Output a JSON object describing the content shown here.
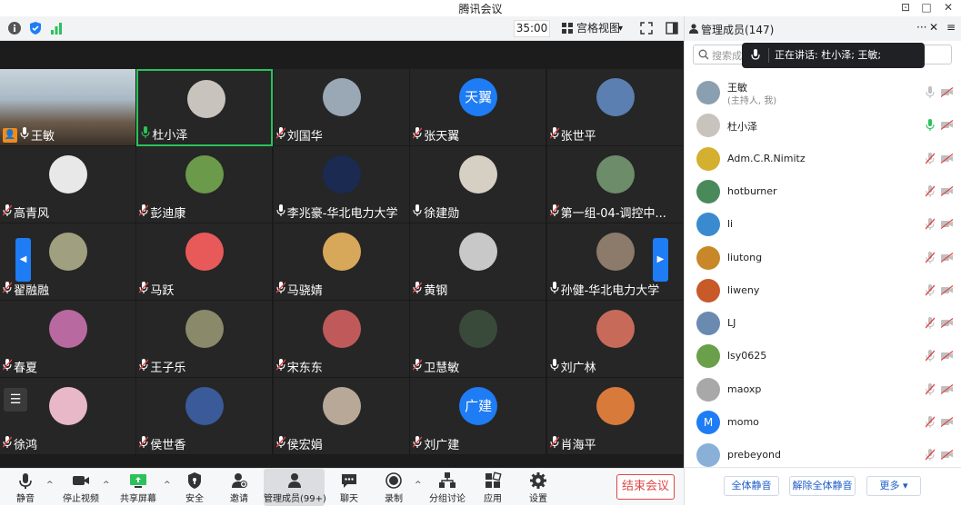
{
  "window": {
    "title": "腾讯会议",
    "pin": "⊡",
    "maximize": "□",
    "close": "✕"
  },
  "topbar": {
    "timer": "35:00",
    "view_mode": "宫格视图",
    "view_caret": "▾"
  },
  "tiles": [
    {
      "name": "王敏",
      "muted": false,
      "host": true,
      "avatar_color": "#8aa0b0"
    },
    {
      "name": "杜小泽",
      "muted": false,
      "active": true,
      "avatar_color": "#c9c3bd"
    },
    {
      "name": "刘国华",
      "muted": true,
      "avatar_color": "#9aa7b5"
    },
    {
      "name": "张天翼",
      "muted": true,
      "avatar_text": "天翼",
      "avatar_color": "#1e7cf5"
    },
    {
      "name": "张世平",
      "muted": true,
      "avatar_color": "#5a7fb0"
    },
    {
      "name": "高青风",
      "muted": true,
      "avatar_color": "#e8e8e8"
    },
    {
      "name": "彭迪康",
      "muted": true,
      "avatar_color": "#6a9a4a"
    },
    {
      "name": "李兆豪-华北电力大学",
      "muted": false,
      "avatar_color": "#1a2a50"
    },
    {
      "name": "徐建勋",
      "muted": false,
      "avatar_color": "#d6cfc4"
    },
    {
      "name": "第一组-04-调控中...",
      "muted": true,
      "avatar_color": "#6c8c6a"
    },
    {
      "name": "翟融融",
      "muted": true,
      "avatar_color": "#a0a080"
    },
    {
      "name": "马跃",
      "muted": true,
      "avatar_color": "#e85a5a"
    },
    {
      "name": "马骁婧",
      "muted": true,
      "avatar_color": "#d8a85a"
    },
    {
      "name": "黄钢",
      "muted": true,
      "avatar_color": "#c8c8c8"
    },
    {
      "name": "孙健-华北电力大学",
      "muted": false,
      "avatar_color": "#8c7a6a"
    },
    {
      "name": "春夏",
      "muted": true,
      "avatar_color": "#b86aa0"
    },
    {
      "name": "王子乐",
      "muted": true,
      "avatar_color": "#8a8a6a"
    },
    {
      "name": "宋东东",
      "muted": true,
      "avatar_color": "#c05a5a"
    },
    {
      "name": "卫慧敏",
      "muted": true,
      "avatar_color": "#3a4a3a"
    },
    {
      "name": "刘广林",
      "muted": false,
      "avatar_color": "#c86a5a"
    },
    {
      "name": "徐鸿",
      "muted": true,
      "avatar_color": "#e8b8c8"
    },
    {
      "name": "侯世香",
      "muted": true,
      "avatar_color": "#3a5a9a"
    },
    {
      "name": "侯宏娟",
      "muted": true,
      "avatar_color": "#b8a898"
    },
    {
      "name": "刘广建",
      "muted": true,
      "avatar_text": "广建",
      "avatar_color": "#1e7cf5"
    },
    {
      "name": "肖海平",
      "muted": true,
      "avatar_color": "#d87a3a"
    }
  ],
  "toolbar": {
    "mute": "静音",
    "stop_video": "停止视频",
    "share_screen": "共享屏幕",
    "security": "安全",
    "invite": "邀请",
    "members": "管理成员(99+)",
    "chat": "聊天",
    "record": "录制",
    "breakout": "分组讨论",
    "apps": "应用",
    "settings": "设置",
    "end_meeting": "结束会议",
    "caret": "^"
  },
  "panel": {
    "title": "管理成员(147)",
    "more": "···",
    "close": "✕",
    "menu": "≡",
    "search_placeholder": "搜索成员",
    "speaking_prefix": "正在讲话: 杜小泽; 王敏;",
    "members": [
      {
        "name": "王敏",
        "sub": "(主持人, 我)",
        "muted": false,
        "mic_active": false,
        "avatar_color": "#8aa0b0"
      },
      {
        "name": "杜小泽",
        "muted": false,
        "mic_active": true,
        "avatar_color": "#c9c3bd"
      },
      {
        "name": "Adm.C.R.Nimitz",
        "muted": true,
        "avatar_color": "#d4b030"
      },
      {
        "name": "hotburner",
        "muted": true,
        "avatar_color": "#4a8a5a"
      },
      {
        "name": "li",
        "muted": true,
        "avatar_color": "#3a8ad0"
      },
      {
        "name": "liutong",
        "muted": true,
        "avatar_color": "#c8882a"
      },
      {
        "name": "liweny",
        "muted": true,
        "avatar_color": "#c85a2a"
      },
      {
        "name": "LJ",
        "muted": true,
        "avatar_color": "#6a8ab0"
      },
      {
        "name": "lsy0625",
        "muted": true,
        "avatar_color": "#6aa04a"
      },
      {
        "name": "maoxp",
        "muted": true,
        "avatar_color": "#a8a8a8"
      },
      {
        "name": "momo",
        "muted": true,
        "avatar_text": "M",
        "avatar_color": "#1e7cf5"
      },
      {
        "name": "prebeyond",
        "muted": true,
        "avatar_color": "#8ab0d8"
      }
    ],
    "footer": {
      "mute_all": "全体静音",
      "unmute_all": "解除全体静音",
      "more": "更多 ▾"
    }
  }
}
